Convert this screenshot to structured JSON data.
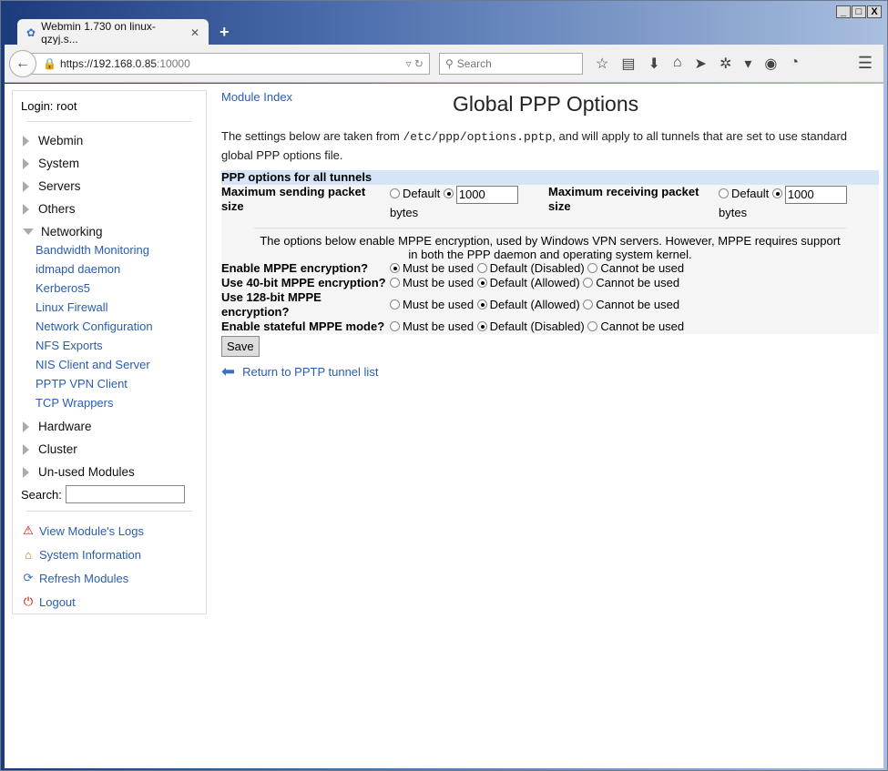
{
  "browser": {
    "tab_title": "Webmin 1.730 on linux-qzyj.s...",
    "url_host": "https://192.168.0.85",
    "url_port": ":10000",
    "search_placeholder": "Search"
  },
  "sidebar": {
    "login": "Login: root",
    "categories": [
      "Webmin",
      "System",
      "Servers",
      "Others"
    ],
    "open_category": "Networking",
    "modules": [
      "Bandwidth Monitoring",
      "idmapd daemon",
      "Kerberos5",
      "Linux Firewall",
      "Network Configuration",
      "NFS Exports",
      "NIS Client and Server",
      "PPTP VPN Client",
      "TCP Wrappers"
    ],
    "categories_after": [
      "Hardware",
      "Cluster",
      "Un-used Modules"
    ],
    "search_label": "Search:",
    "links": [
      "View Module's Logs",
      "System Information",
      "Refresh Modules",
      "Logout"
    ]
  },
  "main": {
    "module_index": "Module Index",
    "title": "Global PPP Options",
    "desc_pre": "The settings below are taken from ",
    "desc_file": "/etc/ppp/options.pptp",
    "desc_post": ", and will apply to all tunnels that are set to use standard global PPP options file.",
    "section": "PPP options for all tunnels",
    "send_label": "Maximum sending packet size",
    "recv_label": "Maximum receiving packet size",
    "default": "Default",
    "bytes": "bytes",
    "send_value": "1000",
    "recv_value": "1000",
    "note": "The options below enable MPPE encryption, used by Windows VPN servers. However, MPPE requires support in both the PPP daemon and operating system kernel.",
    "options": [
      {
        "label": "Enable MPPE encryption?",
        "choices": [
          "Must be used",
          "Default (Disabled)",
          "Cannot be used"
        ],
        "selected": 0
      },
      {
        "label": "Use 40-bit MPPE encryption?",
        "choices": [
          "Must be used",
          "Default (Allowed)",
          "Cannot be used"
        ],
        "selected": 1
      },
      {
        "label": "Use 128-bit MPPE encryption?",
        "choices": [
          "Must be used",
          "Default (Allowed)",
          "Cannot be used"
        ],
        "selected": 1
      },
      {
        "label": "Enable stateful MPPE mode?",
        "choices": [
          "Must be used",
          "Default (Disabled)",
          "Cannot be used"
        ],
        "selected": 1
      }
    ],
    "save": "Save",
    "return": "Return to PPTP tunnel list"
  }
}
